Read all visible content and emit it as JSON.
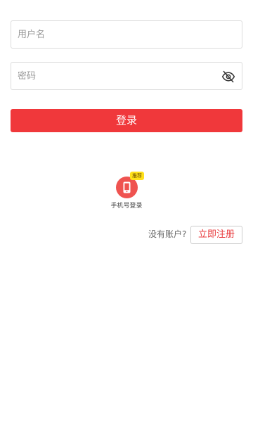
{
  "login_form": {
    "username_placeholder": "用户名",
    "username_value": "",
    "password_placeholder": "密码",
    "password_value": "",
    "password_toggle_icon": "eye-slash-icon",
    "login_label": "登录"
  },
  "alternative_login": {
    "phone_login_label": "手机号登录",
    "recommend_badge": "推荐",
    "phone_icon": "mobile-phone-icon"
  },
  "register": {
    "prompt_text": "没有账户?",
    "register_label": "立即注册"
  },
  "colors": {
    "primary_red": "#f0383b",
    "icon_circle": "#ef5350",
    "badge_yellow": "#ffe01a",
    "border_gray": "#dcdcdc"
  }
}
